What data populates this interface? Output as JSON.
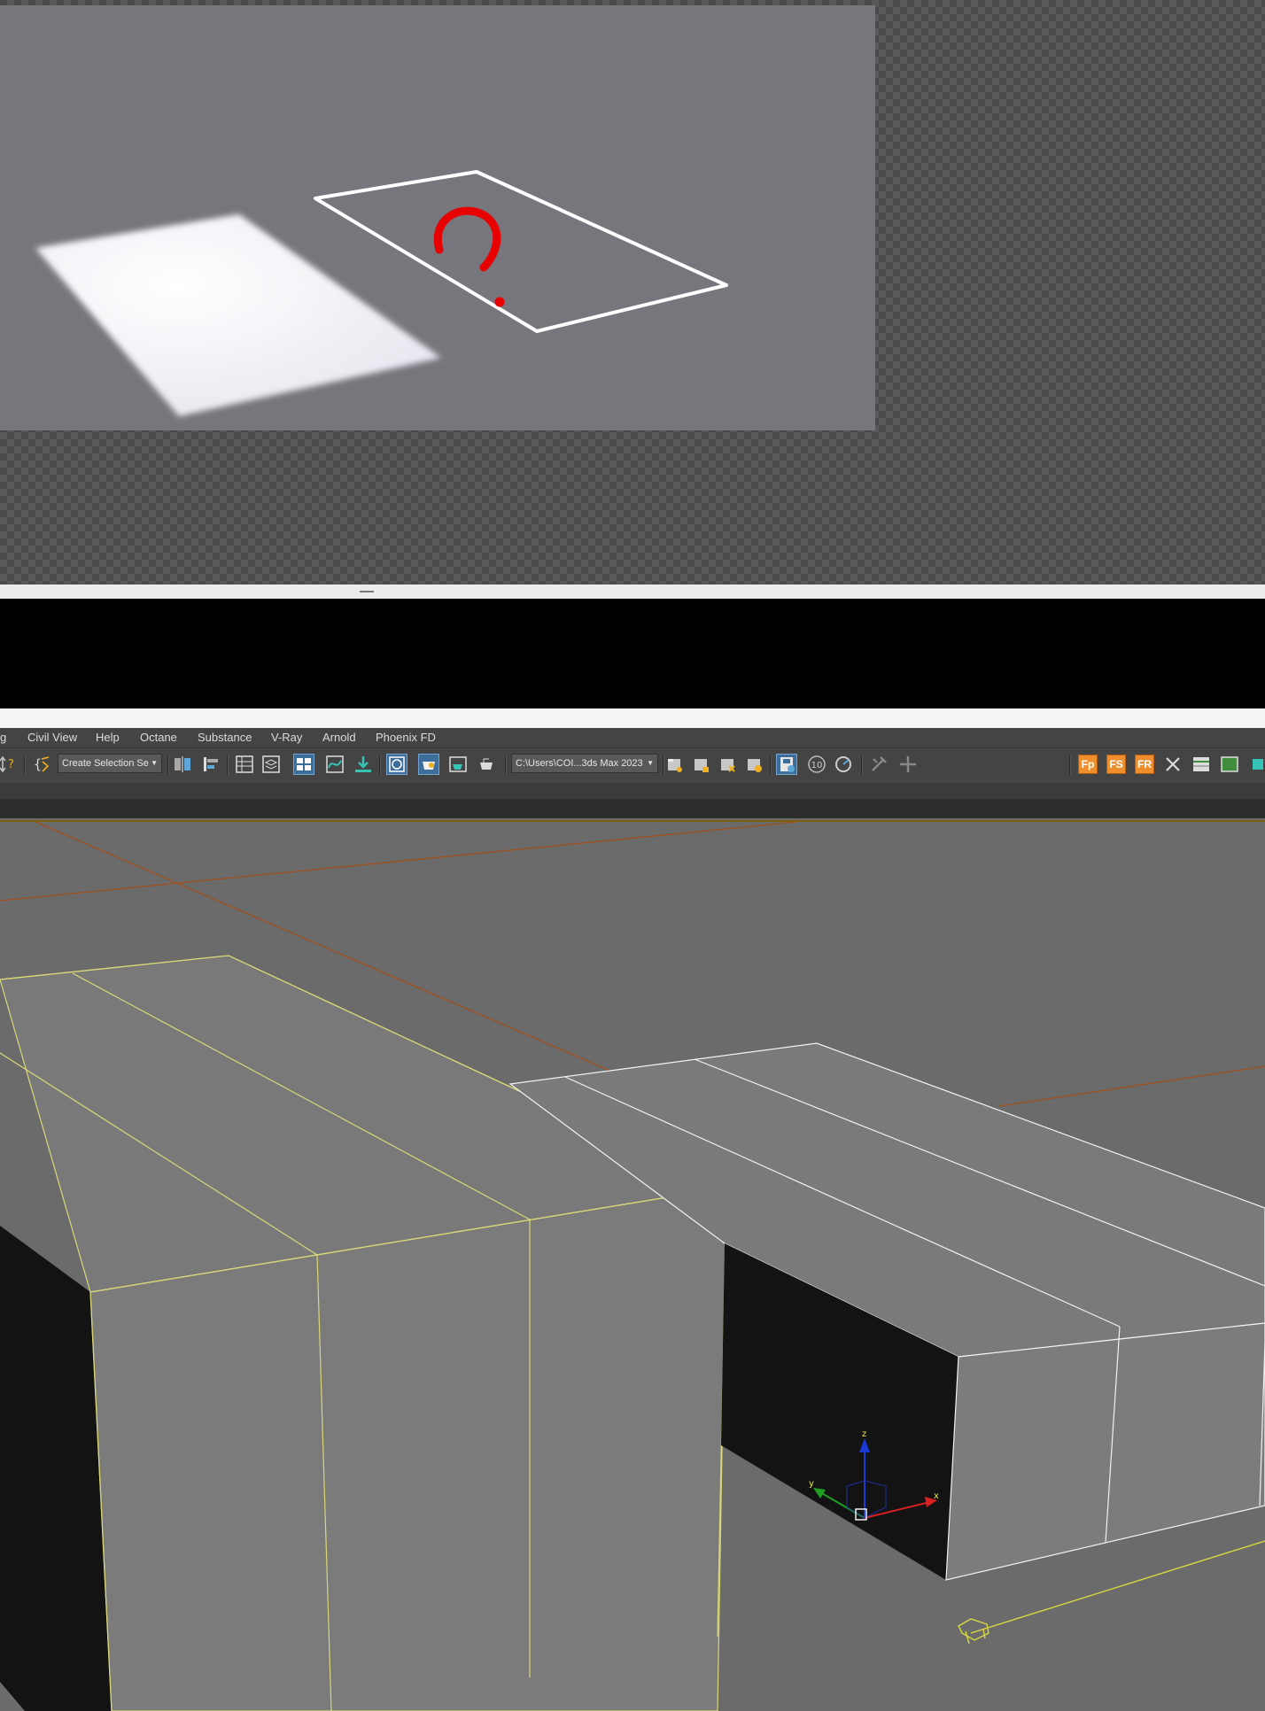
{
  "menu": {
    "items": [
      "g",
      "Civil View",
      "Help",
      "Octane",
      "Substance",
      "V-Ray",
      "Arnold",
      "Phoenix FD"
    ]
  },
  "toolbar": {
    "selection_set_value": "Create Selection Se",
    "project_path_value": "C:\\Users\\COI...3ds Max 2023",
    "spinner_value": "10",
    "orange_icons": [
      "Fp",
      "FS",
      "FR"
    ]
  },
  "render_window": {
    "annotation_mark": "?",
    "annotation_color": "#e80000"
  },
  "viewport": {
    "gizmo_axes": {
      "z": "z",
      "x": "x",
      "y": "y"
    },
    "selection_color": "#d8d878",
    "grid_line_color": "#a0501e"
  }
}
